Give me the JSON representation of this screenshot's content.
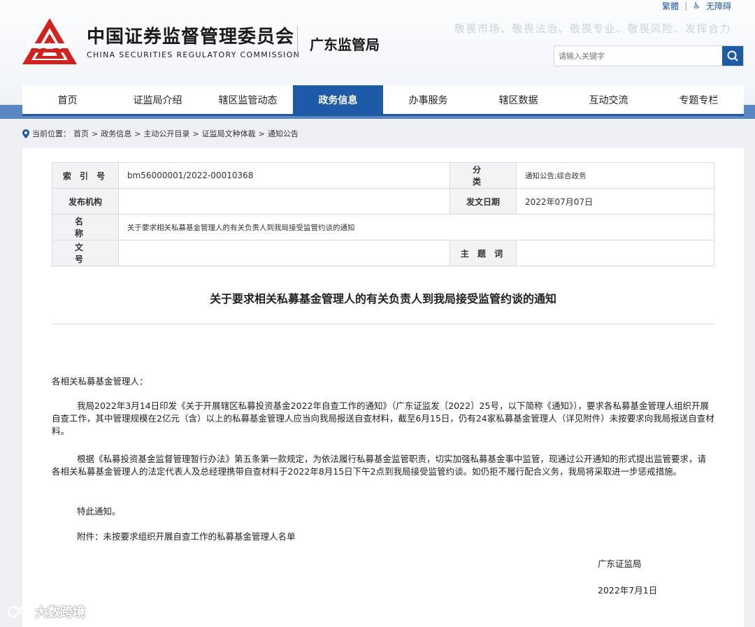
{
  "top_links": {
    "traditional": "繁體",
    "accessibility": "无障碍"
  },
  "header": {
    "cn_title": "中国证券监督管理委员会",
    "en_title": "CHINA SECURITIES REGULATORY COMMISSION",
    "bureau": "广东监管局",
    "motto": "敬畏市场、敬畏法治、敬畏专业、敬畏风险、发挥合力"
  },
  "search": {
    "placeholder": "请输入关键字"
  },
  "nav": {
    "items": [
      {
        "label": "首页"
      },
      {
        "label": "证监局介绍"
      },
      {
        "label": "辖区监管动态"
      },
      {
        "label": "政务信息",
        "active": true
      },
      {
        "label": "办事服务"
      },
      {
        "label": "辖区数据"
      },
      {
        "label": "互动交流"
      },
      {
        "label": "专题专栏"
      }
    ]
  },
  "breadcrumb": {
    "prefix": "当前位置：",
    "items": [
      "首页",
      "政务信息",
      "主动公开目录",
      "证监局文种体裁",
      "通知公告"
    ],
    "separator": ">"
  },
  "meta": {
    "index_label": "索 引 号",
    "index_value": "bm56000001/2022-00010368",
    "category_label": "分 类",
    "category_value": "通知公告;综合政务",
    "publisher_label": "发布机构",
    "publisher_value": "",
    "date_label": "发文日期",
    "date_value": "2022年07月07日",
    "name_label": "名 称",
    "name_value": "关于要求相关私募基金管理人的有关负责人到我局接受监管约谈的通知",
    "docno_label": "文 号",
    "docno_value": "",
    "subject_label": "主 题 词",
    "subject_value": ""
  },
  "document": {
    "title": "关于要求相关私募基金管理人的有关负责人到我局接受监管约谈的通知",
    "salutation": "各相关私募基金管理人：",
    "p1": "我局2022年3月14日印发《关于开展辖区私募投资基金2022年自查工作的通知》（广东证监发〔2022〕25号，以下简称《通知》），要求各私募基金管理人组织开展自查工作，其中管理规模在2亿元（含）以上的私募基金管理人应当向我局报送自查材料，截至6月15日，仍有24家私募基金管理人（详见附件）未按要求向我局报送自查材料。",
    "p2": "根据《私募投资基金监督管理暂行办法》第五条第一款规定，为依法履行私募基金监管职责，切实加强私募基金事中监管，现通过公开通知的形式提出监管要求，请各相关私募基金管理人的法定代表人及总经理携带自查材料于2022年8月15日下午2点到我局接受监管约谈。如仍拒不履行配合义务，我局将采取进一步惩戒措施。",
    "p3": "特此通知。",
    "attachment_label": "附件：",
    "attachment_link": "未按要求组织开展自查工作的私募基金管理人名单",
    "signer": "广东证监局",
    "sign_date": "2022年7月1日"
  },
  "watermark": {
    "text": "大数跨境"
  },
  "colors": {
    "primary": "#1d5aa8",
    "logo_red": "#d7201c",
    "band": "#5b86c4"
  }
}
